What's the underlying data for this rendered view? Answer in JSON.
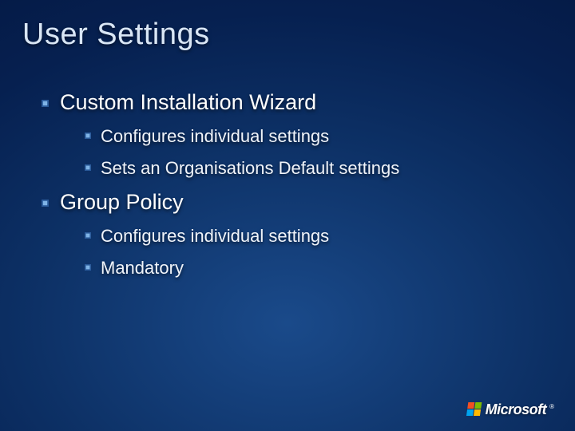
{
  "title": "User Settings",
  "bullets": [
    {
      "label": "Custom Installation Wizard",
      "children": [
        {
          "label": "Configures individual settings"
        },
        {
          "label": "Sets an Organisations Default settings"
        }
      ]
    },
    {
      "label": "Group Policy",
      "children": [
        {
          "label": "Configures individual settings"
        },
        {
          "label": "Mandatory"
        }
      ]
    }
  ],
  "logo": {
    "text": "Microsoft",
    "trademark": "®"
  },
  "colors": {
    "bullet_outer": "#2a5a9a",
    "bullet_inner": "#7fb3e6"
  }
}
